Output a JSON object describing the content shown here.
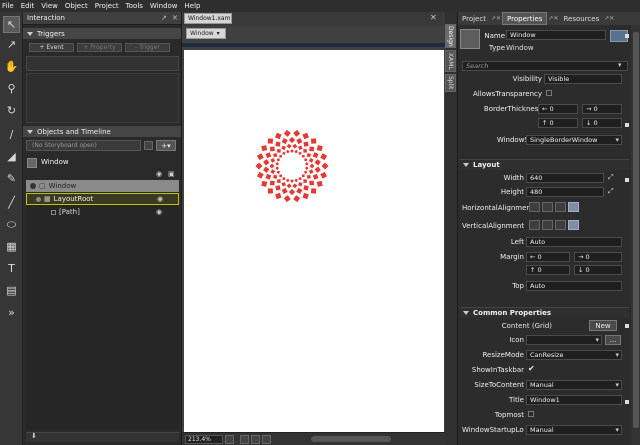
{
  "menubar": {
    "items": [
      "File",
      "Edit",
      "View",
      "Object",
      "Project",
      "Tools",
      "Window",
      "Help"
    ]
  },
  "interaction": {
    "title": "Interaction",
    "triggers_header": "Triggers",
    "event_btn": "+ Event",
    "property_btn": "+ Property",
    "trigger_btn": "- Trigger",
    "objects_header": "Objects and Timeline",
    "storyboard_label": "(No Storyboard open)",
    "window_tab": "Window",
    "tree": [
      {
        "label": "Window"
      },
      {
        "label": "LayoutRoot"
      },
      {
        "label": "[Path]"
      }
    ]
  },
  "document": {
    "tab_label": "Window1.xaml*",
    "window_tab": "Window",
    "side_tabs": [
      "Design",
      "XAML",
      "Split"
    ],
    "zoom": "213.4%"
  },
  "rpanel": {
    "tabs": [
      "Project",
      "Properties",
      "Resources"
    ],
    "name_label": "Name",
    "name_value": "Window",
    "type_label": "Type",
    "type_value": "Window",
    "search_placeholder": "Search",
    "visibility_label": "Visibility",
    "visibility_value": "Visible",
    "allows_transparency_label": "AllowsTransparency",
    "border_thickness_label": "BorderThickness",
    "border_values": [
      "0",
      "0",
      "0",
      "0"
    ],
    "window_style_label": "WindowStyle",
    "window_style_value": "SingleBorderWindow",
    "layout_header": "Layout",
    "width_label": "Width",
    "width_value": "640",
    "height_label": "Height",
    "height_value": "480",
    "halign_label": "HorizontalAlignment",
    "valign_label": "VerticalAlignment",
    "left_label": "Left",
    "left_value": "Auto",
    "margin_label": "Margin",
    "margin_values": [
      "0",
      "0",
      "0",
      "0"
    ],
    "top_label": "Top",
    "top_value": "Auto",
    "common_header": "Common Properties",
    "content_label": "Content",
    "content_value": "(Grid)",
    "new_btn": "New",
    "icon_label": "Icon",
    "browse_btn": "...",
    "resize_mode_label": "ResizeMode",
    "resize_mode_value": "CanResize",
    "show_taskbar_label": "ShowInTaskbar",
    "size_to_content_label": "SizeToContent",
    "size_to_content_value": "Manual",
    "title_label": "Title",
    "title_value": "Window1",
    "topmost_label": "Topmost",
    "startup_label": "WindowStartupLoc...",
    "startup_value": "Manual"
  },
  "colors": {
    "accent": "#e53935",
    "selection": "#c7c000"
  }
}
